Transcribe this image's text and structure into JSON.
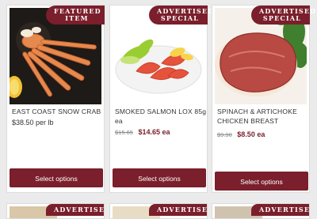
{
  "products": [
    {
      "badge": "FEATURED\nITEM",
      "title": "EAST COAST SNOW CRAB",
      "price_old": "",
      "price": "$38.50 per lb",
      "button": "Select options"
    },
    {
      "badge": "ADVERTISED\nSPECIAL",
      "title": "SMOKED SALMON LOX 85g ea",
      "price_old": "$15.65",
      "price": "$14.65 ea",
      "button": "Select options"
    },
    {
      "badge": "ADVERTISED\nSPECIAL",
      "title": "SPINACH & ARTICHOKE CHICKEN BREAST",
      "price_old": "$9.90",
      "price": "$8.50 ea",
      "button": "Select options"
    }
  ],
  "row2_badges": [
    "ADVERTISED",
    "ADVERTISED",
    "ADVERTISED"
  ],
  "colors": {
    "brand": "#7a1f2b",
    "background": "#ebebeb"
  },
  "icons": [
    "snow-crab-image",
    "smoked-salmon-image",
    "chicken-breast-image"
  ]
}
